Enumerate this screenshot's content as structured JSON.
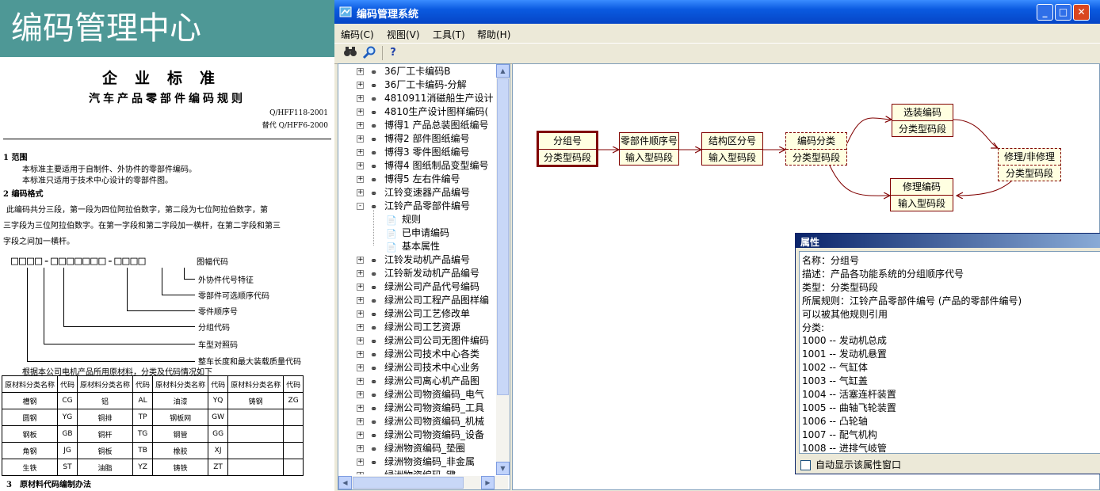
{
  "document": {
    "banner_title": "编码管理中心",
    "title": "企业标准",
    "subtitle": "汽车产品零部件编码规则",
    "code": "Q/HFF118-2001",
    "replaces": "替代 Q/HFF6-2000",
    "section1_heading": "1 范围",
    "section1_line1": "本标准主要适用于自制件、外协件的零部件编码。",
    "section1_line2": "本标准只适用于技术中心设计的零部件图。",
    "section2_heading": "2 编码格式",
    "section2_line1": "此编码共分三段，第一段为四位阿拉伯数字，第二段为七位阿拉伯数字，第",
    "section2_line2": "三字段为三位阿拉伯数字。在第一字段和第二字段加一横杆，在第二字段和第三",
    "section2_line3": "字段之间加一横杆。",
    "code_pattern": "□□□□-□□□□□□□-□□□□",
    "annotations": {
      "drawing_code": "图幅代码",
      "outsourcing": "外协件代号特征",
      "optional_seq": "零部件可选顺序代码",
      "part_seq": "零件顺序号",
      "group_code": "分组代码",
      "vehicle_ref": "车型对照码",
      "vehicle_len": "整车长度和最大装载质量代码"
    },
    "table_caption": "根据本公司电机产品所用原材料，分类及代码情况如下",
    "table_headers": [
      "原材料分类名称",
      "代码",
      "原材料分类名称",
      "代码",
      "原材料分类名称",
      "代码",
      "原材料分类名称",
      "代码"
    ],
    "table_rows": [
      [
        "槽钢",
        "CG",
        "铝",
        "AL",
        "油漆",
        "YQ",
        "铸钢",
        "ZG"
      ],
      [
        "圆钢",
        "YG",
        "铜排",
        "TP",
        "钢板网",
        "GW",
        "",
        ""
      ],
      [
        "钢板",
        "GB",
        "铜杆",
        "TG",
        "钢管",
        "GG",
        "",
        ""
      ],
      [
        "角钢",
        "JG",
        "铜板",
        "TB",
        "橡胶",
        "XJ",
        "",
        ""
      ],
      [
        "生铁",
        "ST",
        "油脂",
        "YZ",
        "铸铁",
        "ZT",
        "",
        ""
      ]
    ],
    "section3_heading": "3　原材料代码编制办法"
  },
  "app": {
    "title": "编码管理系统",
    "menu": [
      "编码(C)",
      "视图(V)",
      "工具(T)",
      "帮助(H)"
    ],
    "toolbar_icons": [
      "binoculars-icon",
      "magnifier-icon",
      "help-icon"
    ],
    "tree": [
      {
        "label": "36厂工卡编码B",
        "level": 0,
        "expander": "+"
      },
      {
        "label": "36厂工卡编码-分解",
        "level": 0,
        "expander": "+"
      },
      {
        "label": "4810911消磁船生产设计",
        "level": 0,
        "expander": "+"
      },
      {
        "label": "4810生产设计图样编码(",
        "level": 0,
        "expander": "+"
      },
      {
        "label": "博得1 产品总装图纸编号",
        "level": 0,
        "expander": "+"
      },
      {
        "label": "博得2 部件图纸编号",
        "level": 0,
        "expander": "+"
      },
      {
        "label": "博得3 零件图纸编号",
        "level": 0,
        "expander": "+"
      },
      {
        "label": "博得4 图纸制品变型编号",
        "level": 0,
        "expander": "+"
      },
      {
        "label": "博得5 左右件编号",
        "level": 0,
        "expander": "+"
      },
      {
        "label": "江铃变速器产品编号",
        "level": 0,
        "expander": "+"
      },
      {
        "label": "江铃产品零部件编号",
        "level": 0,
        "expander": "-"
      },
      {
        "label": "规则",
        "level": 1,
        "expander": ""
      },
      {
        "label": "已申请编码",
        "level": 1,
        "expander": ""
      },
      {
        "label": "基本属性",
        "level": 1,
        "expander": ""
      },
      {
        "label": "江铃发动机产品编号",
        "level": 0,
        "expander": "+"
      },
      {
        "label": "江铃新发动机产品编号",
        "level": 0,
        "expander": "+"
      },
      {
        "label": "绿洲公司产品代号编码",
        "level": 0,
        "expander": "+"
      },
      {
        "label": "绿洲公司工程产品图样编",
        "level": 0,
        "expander": "+"
      },
      {
        "label": "绿洲公司工艺修改单",
        "level": 0,
        "expander": "+"
      },
      {
        "label": "绿洲公司工艺资源",
        "level": 0,
        "expander": "+"
      },
      {
        "label": "绿洲公司公司无图件编码",
        "level": 0,
        "expander": "+"
      },
      {
        "label": "绿洲公司技术中心各类",
        "level": 0,
        "expander": "+"
      },
      {
        "label": "绿洲公司技术中心业务",
        "level": 0,
        "expander": "+"
      },
      {
        "label": "绿洲公司离心机产品图",
        "level": 0,
        "expander": "+"
      },
      {
        "label": "绿洲公司物资编码_电气",
        "level": 0,
        "expander": "+"
      },
      {
        "label": "绿洲公司物资编码_工具",
        "level": 0,
        "expander": "+"
      },
      {
        "label": "绿洲公司物资编码_机械",
        "level": 0,
        "expander": "+"
      },
      {
        "label": "绿洲公司物资编码_设备",
        "level": 0,
        "expander": "+"
      },
      {
        "label": "绿洲物资编码_垫圈",
        "level": 0,
        "expander": "+"
      },
      {
        "label": "绿洲物资编码_非金属",
        "level": 0,
        "expander": "+"
      },
      {
        "label": "绿洲物资编码_键",
        "level": 0,
        "expander": "+"
      }
    ],
    "nodes": {
      "group": {
        "top": "分组号",
        "bottom": "分类型码段"
      },
      "part_seq": {
        "top": "零部件顺序号",
        "bottom": "输入型码段"
      },
      "structure": {
        "top": "结构区分号",
        "bottom": "输入型码段"
      },
      "classify": {
        "top": "编码分类",
        "bottom": "分类型码段"
      },
      "option": {
        "top": "选装编码",
        "bottom": "分类型码段"
      },
      "repair": {
        "top": "修理编码",
        "bottom": "输入型码段"
      },
      "repair_or_not": {
        "top": "修理/非修理",
        "bottom": "分类型码段"
      }
    },
    "property_window": {
      "title": "属性",
      "lines": [
        "名称：分组号",
        "描述：产品各功能系统的分组顺序代号",
        "类型：分类型码段",
        "所属规则：江铃产品零部件编号 (产品的零部件编号)",
        "可以被其他规则引用",
        "分类:",
        "1000 -- 发动机总成",
        "1001 -- 发动机悬置",
        "1002 -- 气缸体",
        "1003 -- 气缸盖",
        "1004 -- 活塞连杆装置",
        "1005 -- 曲轴飞轮装置",
        "1006 -- 凸轮轴",
        "1007 -- 配气机构",
        "1008 -- 进排气岐管"
      ],
      "auto_show_label": "自动显示该属性窗口"
    },
    "colors": {
      "node_border": "#800000",
      "node_fill": "#ffffe1",
      "titlebar": "#0a5ae0",
      "banner": "#4e9896"
    }
  }
}
